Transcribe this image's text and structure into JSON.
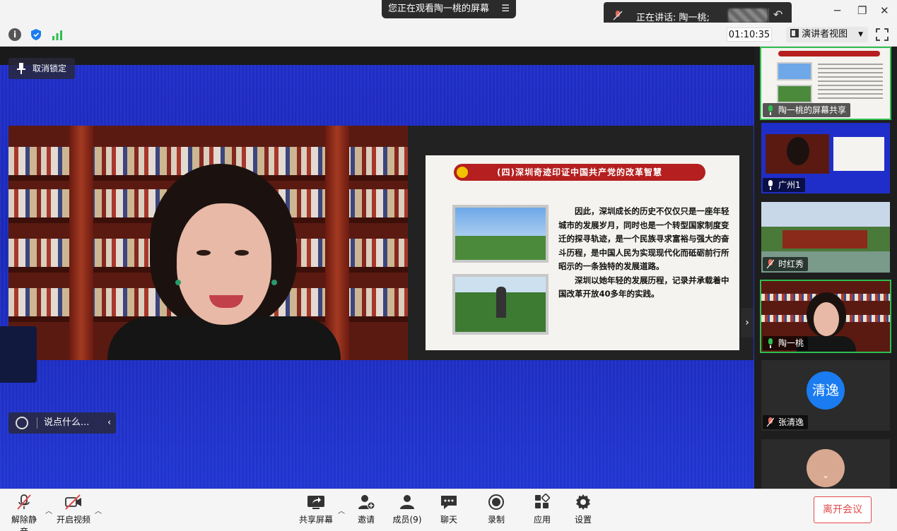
{
  "titlebar": {
    "share_notice": "您正在观看陶一桃的屏幕",
    "speaking_label": "正在讲话: 陶一桃;"
  },
  "toolbar": {
    "timer": "01:10:35",
    "view_mode": "演讲者视图"
  },
  "stage": {
    "unlock_label": "取消锁定",
    "chat_placeholder": "说点什么..."
  },
  "slide": {
    "title": "(四)深圳奇迹印证中国共产党的改革智慧",
    "paragraph1": "因此，深圳成长的历史不仅仅只是一座年轻城市的发展岁月，同时也是一个转型国家制度变迁的探寻轨迹，是一个民族寻求富裕与强大的奋斗历程，是中国人民为实现现代化而砥砺前行所昭示的一条独特的发展道路。",
    "paragraph2": "深圳以她年轻的发展历程，记录并承载着中国改革开放40多年的实践。"
  },
  "sidebar": {
    "tiles": [
      {
        "label": "陶一桃的屏幕共享"
      },
      {
        "label": "广州1"
      },
      {
        "label": "时红秀"
      },
      {
        "label": "陶一桃"
      },
      {
        "label": "张清逸",
        "avatar_text": "清逸"
      }
    ]
  },
  "bottombar": {
    "unmute": "解除静音",
    "start_video": "开启视频",
    "share_screen": "共享屏幕",
    "invite": "邀请",
    "members": "成员(9)",
    "chat": "聊天",
    "record": "录制",
    "apps": "应用",
    "settings": "设置",
    "leave": "离开会议"
  },
  "colors": {
    "accent_green": "#2fbf4f",
    "leave_red": "#e34b4b",
    "avatar_blue": "#1a7cf0"
  }
}
